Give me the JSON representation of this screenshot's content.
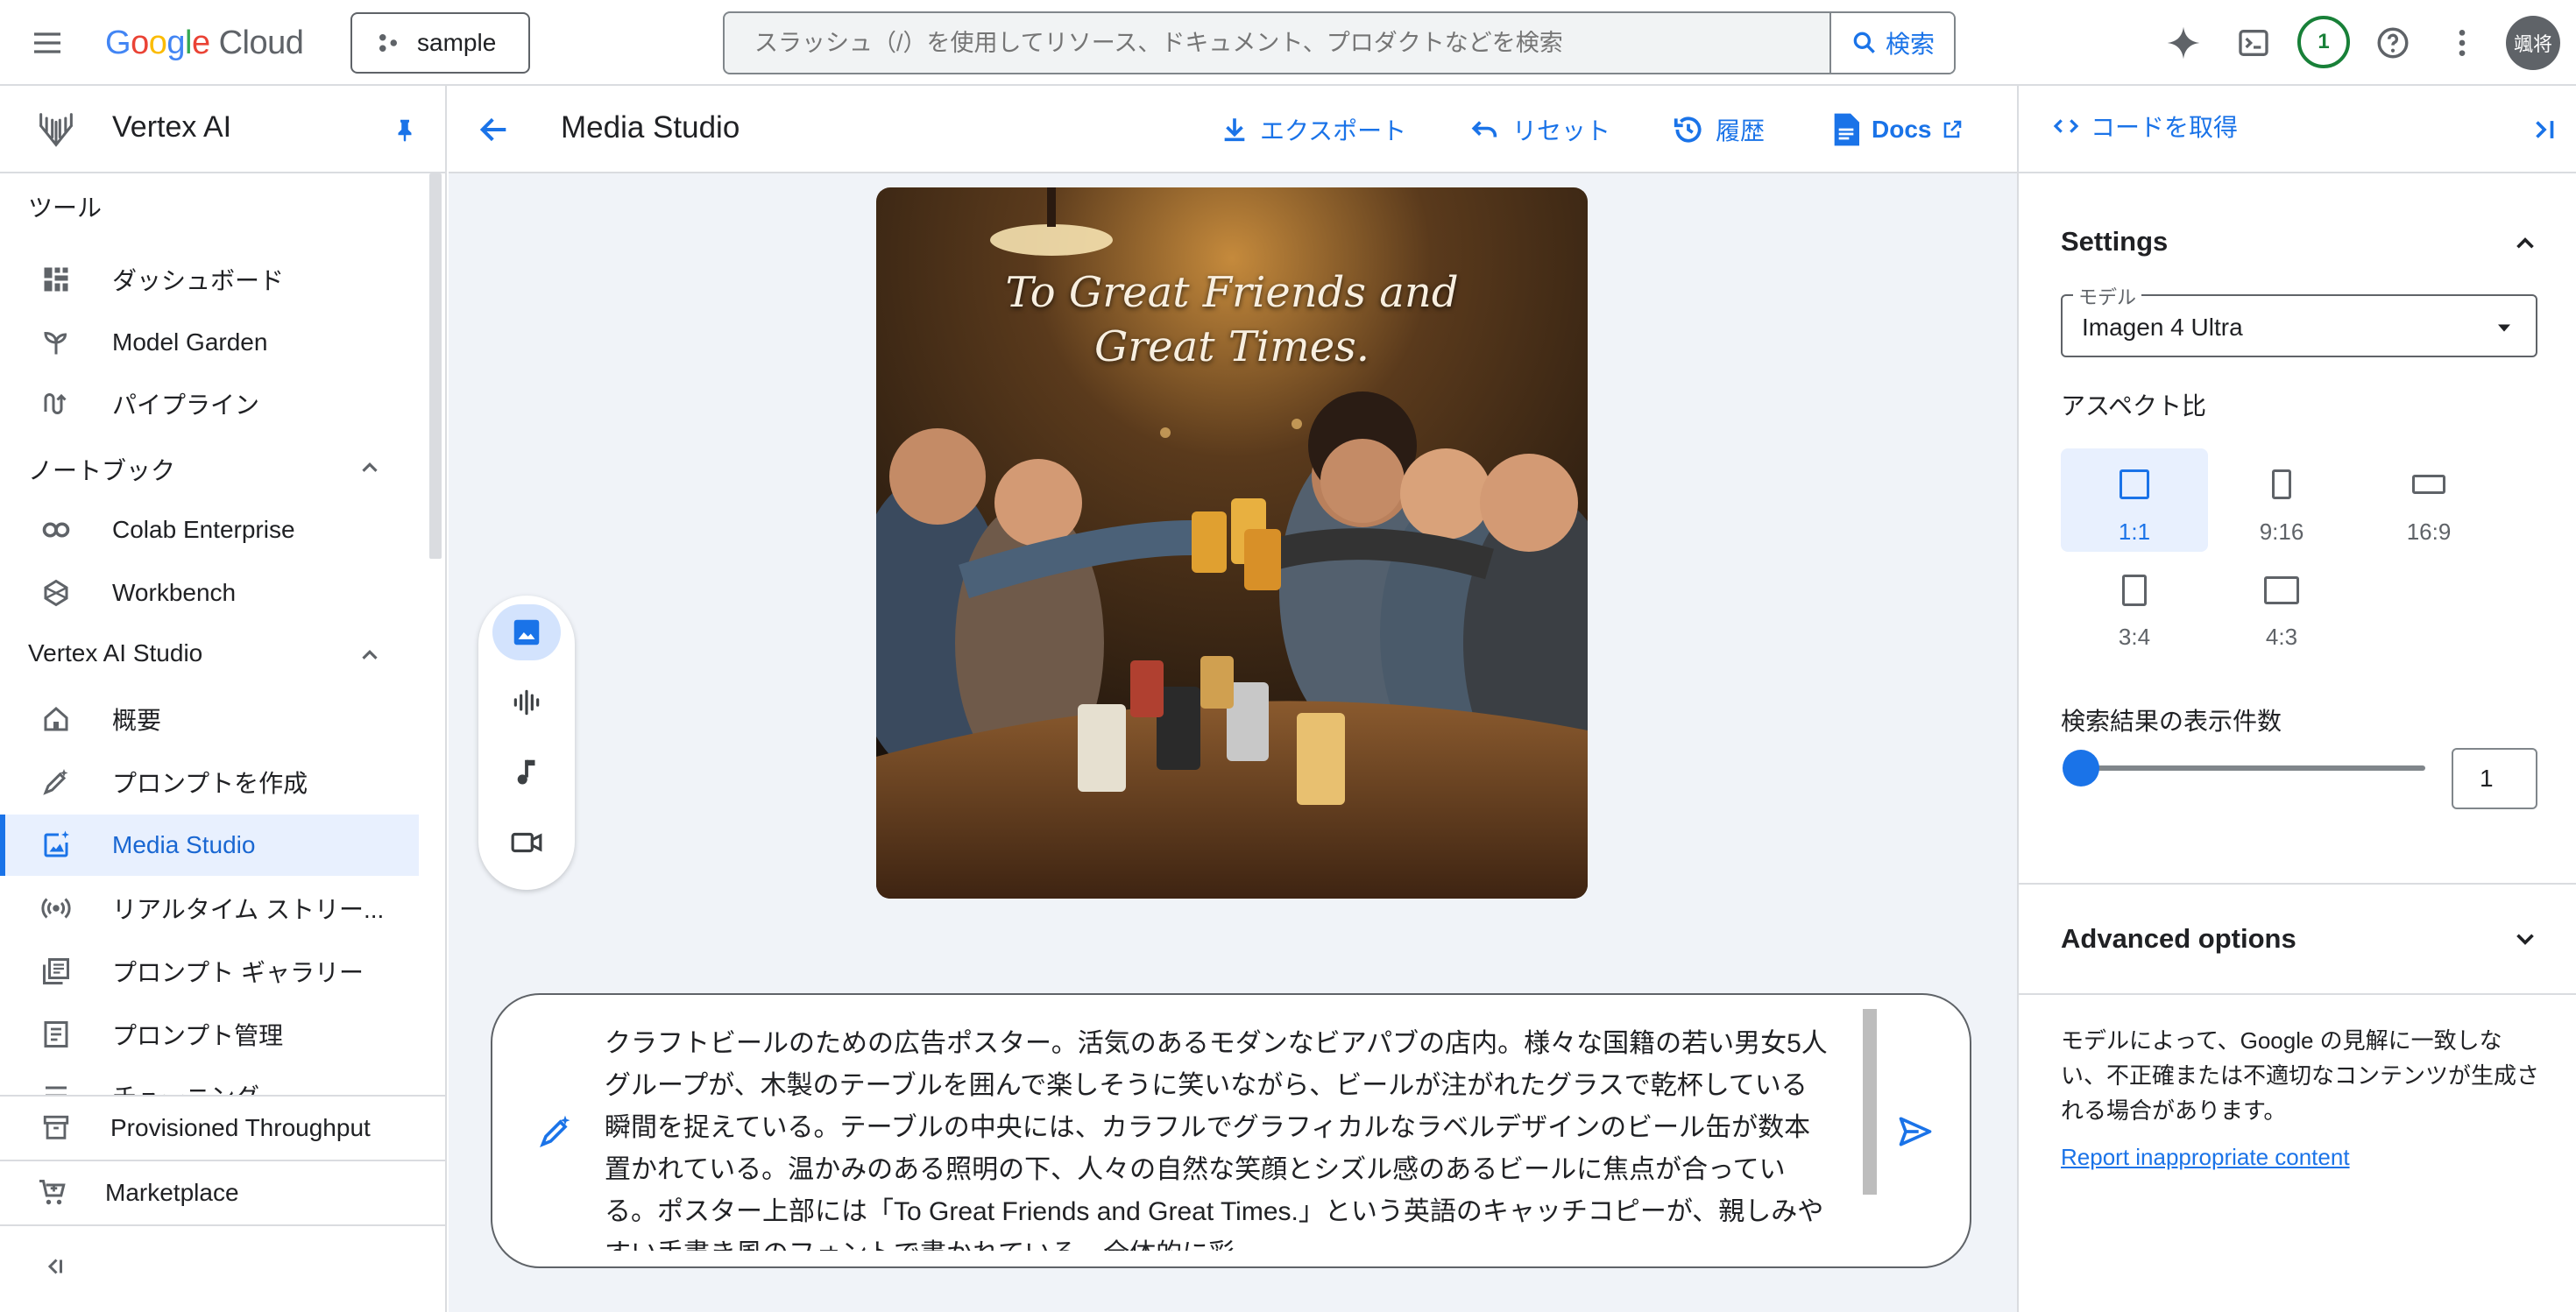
{
  "topbar": {
    "logo_parts": [
      "G",
      "o",
      "o",
      "g",
      "l",
      "e"
    ],
    "logo_suffix": "Cloud",
    "project": "sample",
    "search_placeholder": "スラッシュ（/）を使用してリソース、ドキュメント、プロダクトなどを検索",
    "search_button": "検索",
    "notification_count": "1",
    "avatar_text": "颯将"
  },
  "sidebar": {
    "title": "Vertex AI",
    "sections": {
      "tools": "ツール",
      "notebooks": "ノートブック",
      "studio": "Vertex AI Studio"
    },
    "items": {
      "dashboard": "ダッシュボード",
      "model_garden": "Model Garden",
      "pipelines": "パイプライン",
      "colab": "Colab Enterprise",
      "workbench": "Workbench",
      "overview": "概要",
      "create_prompt": "プロンプトを作成",
      "media_studio": "Media Studio",
      "realtime": "リアルタイム ストリー...",
      "prompt_gallery": "プロンプト ギャラリー",
      "prompt_management": "プロンプト管理",
      "tuning": "チューニング"
    },
    "bottom": {
      "provisioned": "Provisioned Throughput",
      "marketplace": "Marketplace"
    }
  },
  "header": {
    "title": "Media Studio",
    "export": "エクスポート",
    "reset": "リセット",
    "history": "履歴",
    "docs": "Docs"
  },
  "canvas": {
    "poster_line1": "To Great Friends and",
    "poster_line2": "Great Times.",
    "prompt": "クラフトビールのための広告ポスター。活気のあるモダンなビアパブの店内。様々な国籍の若い男女5人グループが、木製のテーブルを囲んで楽しそうに笑いながら、ビールが注がれたグラスで乾杯している瞬間を捉えている。テーブルの中央には、カラフルでグラフィカルなラベルデザインのビール缶が数本置かれている。温かみのある照明の下、人々の自然な笑顔とシズル感のあるビールに焦点が合っている。ポスター上部には「To Great Friends and Great Times.」という英語のキャッチコピーが、親しみやすい手書き風のフォントで書かれている。全体的に彩"
  },
  "panel": {
    "get_code": "コードを取得",
    "settings": "Settings",
    "model_label": "モデル",
    "model_value": "Imagen 4 Ultra",
    "aspect_title": "アスペクト比",
    "aspects": [
      "1:1",
      "9:16",
      "16:9",
      "3:4",
      "4:3"
    ],
    "aspect_selected": "1:1",
    "count_title": "検索結果の表示件数",
    "count_value": "1",
    "advanced": "Advanced options",
    "disclaimer": "モデルによって、Google の見解に一致しない、不正確または不適切なコンテンツが生成される場合があります。",
    "report": "Report inappropriate content"
  },
  "colors": {
    "accent": "#1a73e8",
    "active_bg": "#e8f0fe",
    "canvas_bg": "#f0f3f8",
    "badge_green": "#188038"
  }
}
